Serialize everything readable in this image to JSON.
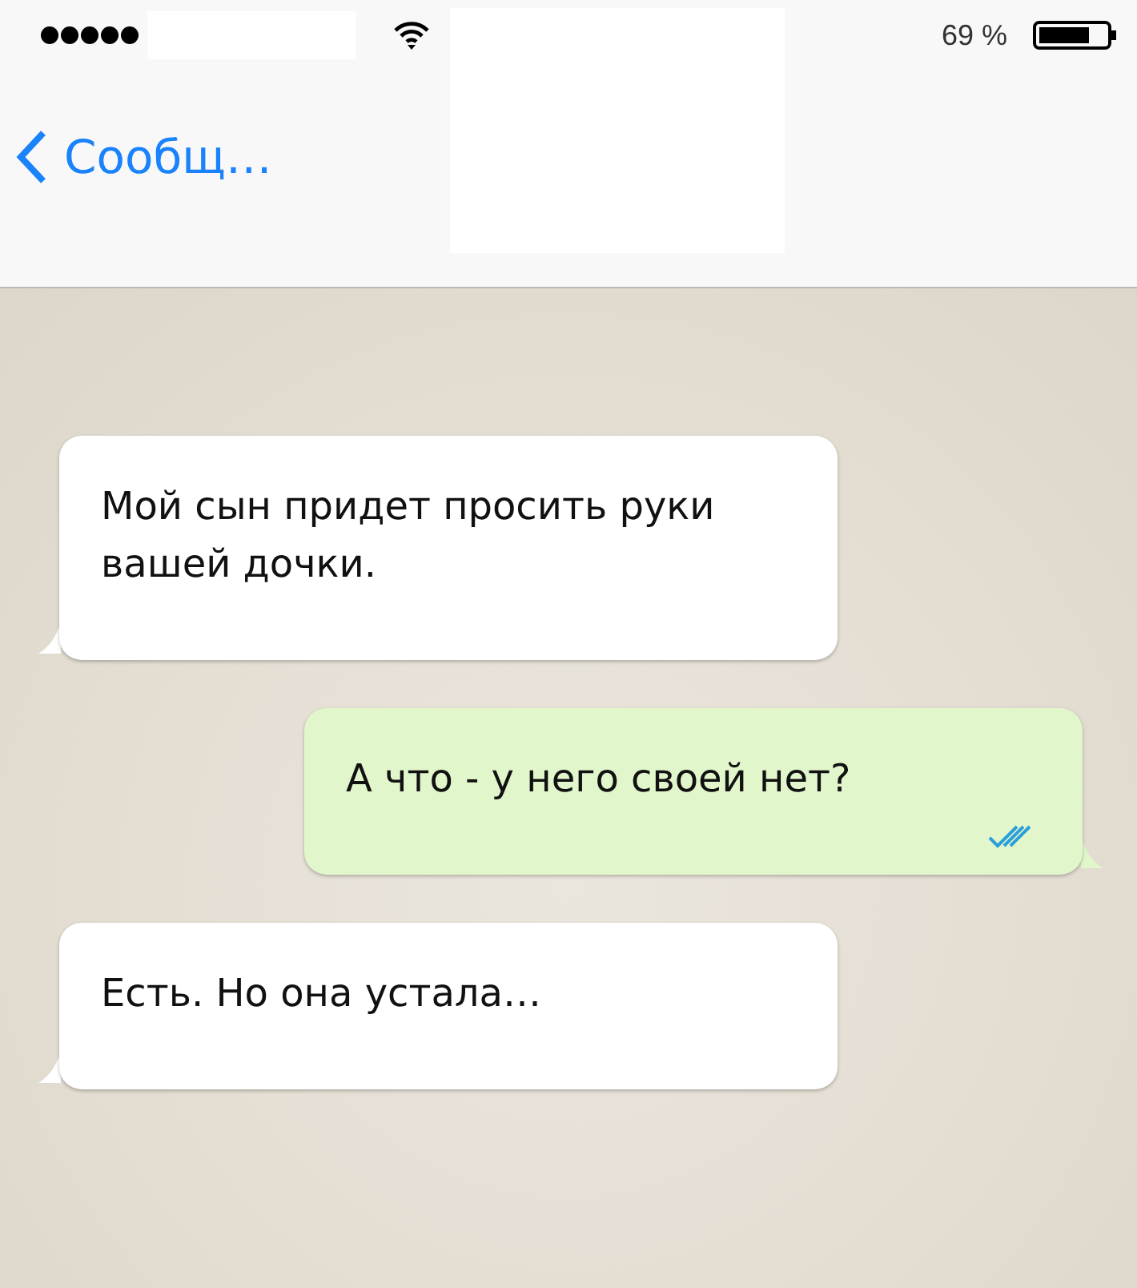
{
  "status_bar": {
    "battery_percent": "69 %"
  },
  "nav_bar": {
    "back_label": "Сообщ…"
  },
  "messages": [
    {
      "kind": "incoming",
      "text": "Мой сын придет просить руки вашей дочки."
    },
    {
      "kind": "outgoing",
      "text": "А что - у него своей нет?",
      "read": true
    },
    {
      "kind": "incoming",
      "text": "Есть. Но она устала…"
    }
  ]
}
